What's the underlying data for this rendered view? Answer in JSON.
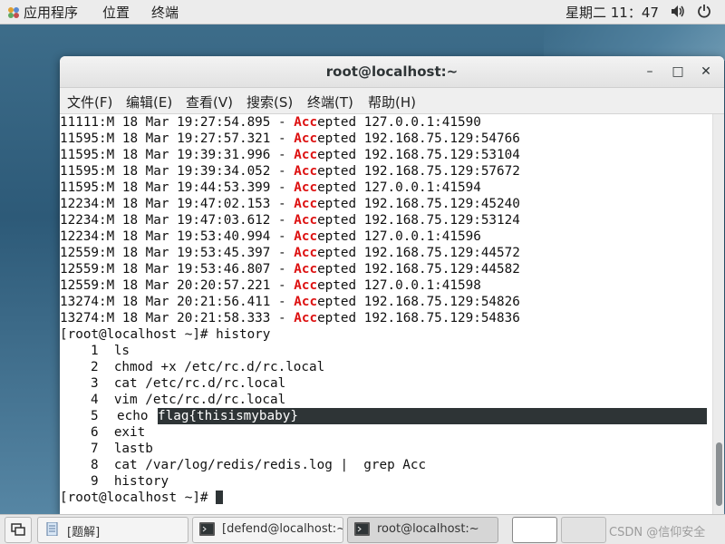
{
  "topbar": {
    "applications": "应用程序",
    "places": "位置",
    "terminal": "终端",
    "clock": "星期二 11：47"
  },
  "window": {
    "title": "root@localhost:~",
    "menus": [
      "文件(F)",
      "编辑(E)",
      "查看(V)",
      "搜索(S)",
      "终端(T)",
      "帮助(H)"
    ]
  },
  "terminal": {
    "log_lines": [
      {
        "prefix": "11111:M 18 Mar 19:27:54.895 - ",
        "acc": "Acc",
        "rest": "epted 127.0.0.1:41590"
      },
      {
        "prefix": "11595:M 18 Mar 19:27:57.321 - ",
        "acc": "Acc",
        "rest": "epted 192.168.75.129:54766"
      },
      {
        "prefix": "11595:M 18 Mar 19:39:31.996 - ",
        "acc": "Acc",
        "rest": "epted 192.168.75.129:53104"
      },
      {
        "prefix": "11595:M 18 Mar 19:39:34.052 - ",
        "acc": "Acc",
        "rest": "epted 192.168.75.129:57672"
      },
      {
        "prefix": "11595:M 18 Mar 19:44:53.399 - ",
        "acc": "Acc",
        "rest": "epted 127.0.0.1:41594"
      },
      {
        "prefix": "12234:M 18 Mar 19:47:02.153 - ",
        "acc": "Acc",
        "rest": "epted 192.168.75.129:45240"
      },
      {
        "prefix": "12234:M 18 Mar 19:47:03.612 - ",
        "acc": "Acc",
        "rest": "epted 192.168.75.129:53124"
      },
      {
        "prefix": "12234:M 18 Mar 19:53:40.994 - ",
        "acc": "Acc",
        "rest": "epted 127.0.0.1:41596"
      },
      {
        "prefix": "12559:M 18 Mar 19:53:45.397 - ",
        "acc": "Acc",
        "rest": "epted 192.168.75.129:44572"
      },
      {
        "prefix": "12559:M 18 Mar 19:53:46.807 - ",
        "acc": "Acc",
        "rest": "epted 192.168.75.129:44582"
      },
      {
        "prefix": "12559:M 18 Mar 20:20:57.221 - ",
        "acc": "Acc",
        "rest": "epted 127.0.0.1:41598"
      },
      {
        "prefix": "13274:M 18 Mar 20:21:56.411 - ",
        "acc": "Acc",
        "rest": "epted 192.168.75.129:54826"
      },
      {
        "prefix": "13274:M 18 Mar 20:21:58.333 - ",
        "acc": "Acc",
        "rest": "epted 192.168.75.129:54836"
      }
    ],
    "prompt_command": "[root@localhost ~]# history",
    "history": [
      {
        "n": "1",
        "cmd": "ls"
      },
      {
        "n": "2",
        "cmd": "chmod +x /etc/rc.d/rc.local"
      },
      {
        "n": "3",
        "cmd": "cat /etc/rc.d/rc.local"
      },
      {
        "n": "4",
        "cmd": "vim /etc/rc.d/rc.local"
      },
      {
        "n": "5",
        "cmd": "echo ",
        "selected": "flag{thisismybaby}"
      },
      {
        "n": "6",
        "cmd": "exit"
      },
      {
        "n": "7",
        "cmd": "lastb"
      },
      {
        "n": "8",
        "cmd": "cat /var/log/redis/redis.log |  grep Acc"
      },
      {
        "n": "9",
        "cmd": "history"
      }
    ],
    "final_prompt": "[root@localhost ~]# ",
    "accent_color": "#dd1111"
  },
  "taskbar": {
    "tasks": [
      "[题解]",
      "[defend@localhost:~",
      "root@localhost:~"
    ],
    "watermark": "CSDN @信仰安全"
  },
  "icons": {
    "apps": "apps-menu-icon",
    "volume": "volume-icon",
    "power": "power-icon",
    "show_desktop": "show-desktop-icon"
  }
}
